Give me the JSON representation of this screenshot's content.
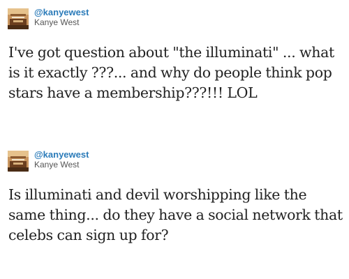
{
  "tweets": [
    {
      "handle": "@kanyewest",
      "name": "Kanye West",
      "avatar_icon": "kanye-avatar",
      "text": "I've got question about \"the illuminati\" ... what is it exactly ???... and why do people think pop stars have a membership???!!! LOL"
    },
    {
      "handle": "@kanyewest",
      "name": "Kanye West",
      "avatar_icon": "kanye-avatar",
      "text": "Is illuminati and devil worshipping like the same thing... do they have a social network that celebs can sign up for?"
    }
  ],
  "colors": {
    "handle": "#2b7bb9",
    "name": "#555555",
    "text": "#222222",
    "background": "#ffffff"
  }
}
